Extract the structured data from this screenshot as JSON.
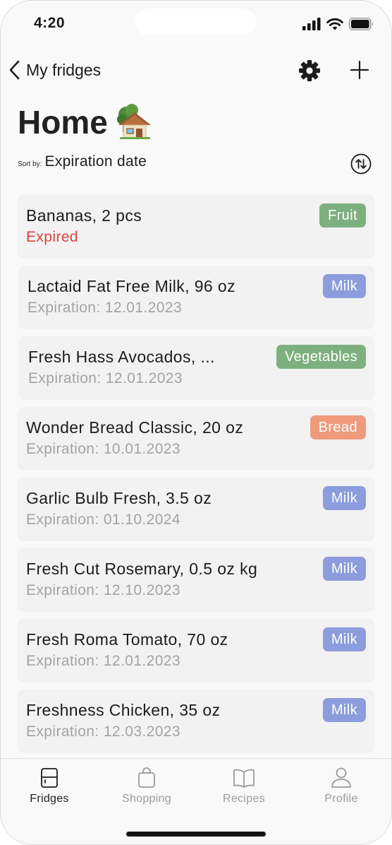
{
  "status_bar": {
    "time": "4:20"
  },
  "nav": {
    "back_label": "My fridges",
    "settings_icon": "gear-icon",
    "add_icon": "plus-icon"
  },
  "header": {
    "title": "Home",
    "title_icon": "house-with-tree-icon"
  },
  "sort": {
    "label": "Sort by:",
    "value": "Expiration date"
  },
  "colors": {
    "fruit": "#7db07e",
    "vegetables": "#7db07e",
    "milk": "#8c9cdc",
    "bread": "#ef9a7c",
    "expired": "#d9433b"
  },
  "items": [
    {
      "name": "Bananas, 2 pcs",
      "expiration": "Expired",
      "expired": true,
      "tag": "Fruit",
      "tag_color": "#7db07e"
    },
    {
      "name": "Lactaid Fat Free Milk, 96 oz",
      "expiration": "Expiration: 12.01.2023",
      "tag": "Milk",
      "tag_color": "#8c9cdc"
    },
    {
      "name": "Fresh Hass Avocados, ...",
      "expiration": "Expiration: 12.01.2023",
      "tag": "Vegetables",
      "tag_color": "#7db07e"
    },
    {
      "name": "Wonder Bread Classic, 20 oz",
      "expiration": "Expiration: 10.01.2023",
      "tag": "Bread",
      "tag_color": "#ef9a7c"
    },
    {
      "name": "Garlic Bulb Fresh, 3.5 oz",
      "expiration": "Expiration: 01.10.2024",
      "tag": "Milk",
      "tag_color": "#8c9cdc"
    },
    {
      "name": "Fresh Cut Rosemary, 0.5 oz kg",
      "expiration": "Expiration: 12.10.2023",
      "tag": "Milk",
      "tag_color": "#8c9cdc"
    },
    {
      "name": "Fresh Roma Tomato, 70 oz",
      "expiration": "Expiration: 12.01.2023",
      "tag": "Milk",
      "tag_color": "#8c9cdc"
    },
    {
      "name": "Freshness Chicken, 35 oz",
      "expiration": "Expiration: 12.03.2023",
      "tag": "Milk",
      "tag_color": "#8c9cdc"
    }
  ],
  "tabs": [
    {
      "label": "Fridges",
      "icon": "fridge-icon",
      "active": true
    },
    {
      "label": "Shopping",
      "icon": "shopping-bag-icon",
      "active": false
    },
    {
      "label": "Recipes",
      "icon": "book-icon",
      "active": false
    },
    {
      "label": "Profile",
      "icon": "person-icon",
      "active": false
    }
  ]
}
